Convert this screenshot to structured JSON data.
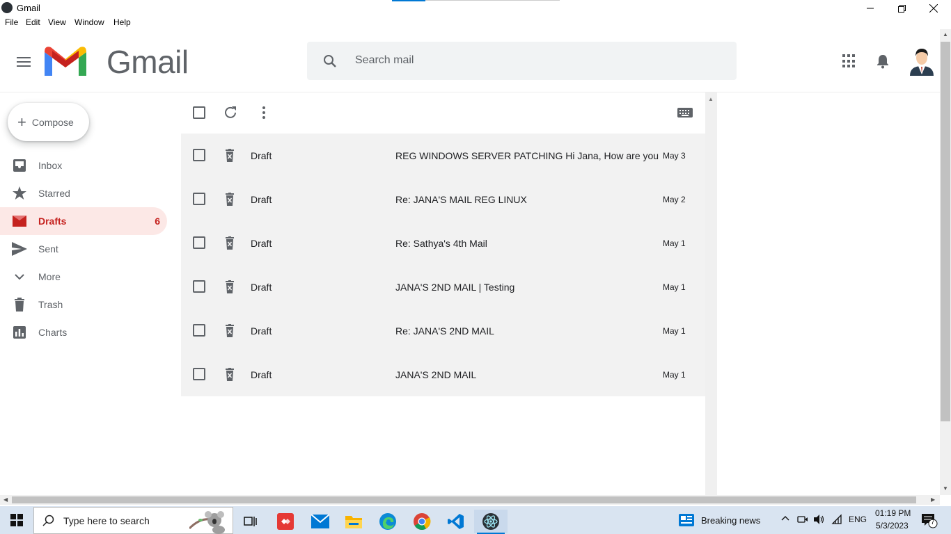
{
  "window": {
    "title": "Gmail",
    "menu": [
      "File",
      "Edit",
      "View",
      "Window",
      "Help"
    ]
  },
  "header": {
    "logo_text": "Gmail",
    "search_placeholder": "Search mail"
  },
  "sidebar": {
    "compose_label": "Compose",
    "items": [
      {
        "label": "Inbox",
        "icon": "inbox-icon",
        "count": ""
      },
      {
        "label": "Starred",
        "icon": "star-icon",
        "count": ""
      },
      {
        "label": "Drafts",
        "icon": "drafts-icon",
        "count": "6",
        "active": true
      },
      {
        "label": "Sent",
        "icon": "send-icon",
        "count": ""
      },
      {
        "label": "More",
        "icon": "chevron-down-icon",
        "count": ""
      },
      {
        "label": "Trash",
        "icon": "trash-icon",
        "count": ""
      },
      {
        "label": "Charts",
        "icon": "chart-icon",
        "count": ""
      }
    ]
  },
  "emails": [
    {
      "sender": "Draft",
      "subject": "REG WINDOWS SERVER PATCHING  Hi Jana, How are you",
      "date": "May 3"
    },
    {
      "sender": "Draft",
      "subject": "Re: JANA'S MAIL REG LINUX",
      "date": "May 2"
    },
    {
      "sender": "Draft",
      "subject": "Re: Sathya's 4th Mail",
      "date": "May 1"
    },
    {
      "sender": "Draft",
      "subject": "JANA'S 2ND MAIL | Testing",
      "date": "May 1"
    },
    {
      "sender": "Draft",
      "subject": "Re: JANA'S 2ND MAIL",
      "date": "May 1"
    },
    {
      "sender": "Draft",
      "subject": "JANA'S 2ND MAIL",
      "date": "May 1"
    }
  ],
  "taskbar": {
    "search_placeholder": "Type here to search",
    "news_label": "Breaking news",
    "language": "ENG",
    "time": "01:19 PM",
    "date": "5/3/2023",
    "notification_count": "7"
  },
  "colors": {
    "accent_red": "#c5221f",
    "active_bg": "#fce8e6",
    "list_bg": "#f2f2f2"
  }
}
